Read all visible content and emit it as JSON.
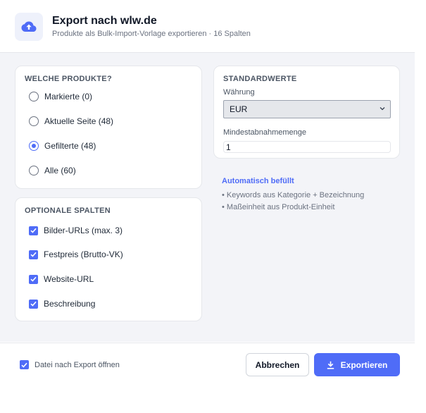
{
  "header": {
    "title": "Export nach wlw.de",
    "subtitle": "Produkte als Bulk-Import-Vorlage exportieren · 16 Spalten",
    "icon": "cloud-upload-icon"
  },
  "products": {
    "title": "WELCHE PRODUKTE?",
    "options": [
      {
        "label": "Markierte (0)",
        "selected": false
      },
      {
        "label": "Aktuelle Seite (48)",
        "selected": false
      },
      {
        "label": "Gefilterte (48)",
        "selected": true
      },
      {
        "label": "Alle (60)",
        "selected": false
      }
    ]
  },
  "columns": {
    "title": "OPTIONALE SPALTEN",
    "options": [
      {
        "label": "Bilder-URLs (max. 3)",
        "checked": true
      },
      {
        "label": "Festpreis (Brutto-VK)",
        "checked": true
      },
      {
        "label": "Website-URL",
        "checked": true
      },
      {
        "label": "Beschreibung",
        "checked": true
      }
    ]
  },
  "defaults": {
    "title": "STANDARDWERTE",
    "currency_label": "Währung",
    "currency_value": "EUR",
    "min_qty_label": "Mindestabnahmemenge",
    "min_qty_value": "1"
  },
  "auto": {
    "title": "Automatisch befüllt",
    "items": [
      "• Keywords aus Kategorie + Bezeichnung",
      "• Maßeinheit aus Produkt-Einheit"
    ]
  },
  "footer": {
    "open_after_label": "Datei nach Export öffnen",
    "open_after_checked": true,
    "cancel_label": "Abbrechen",
    "export_label": "Exportieren"
  },
  "colors": {
    "accent": "#4f6cf7",
    "body_bg": "#f3f4f8"
  }
}
